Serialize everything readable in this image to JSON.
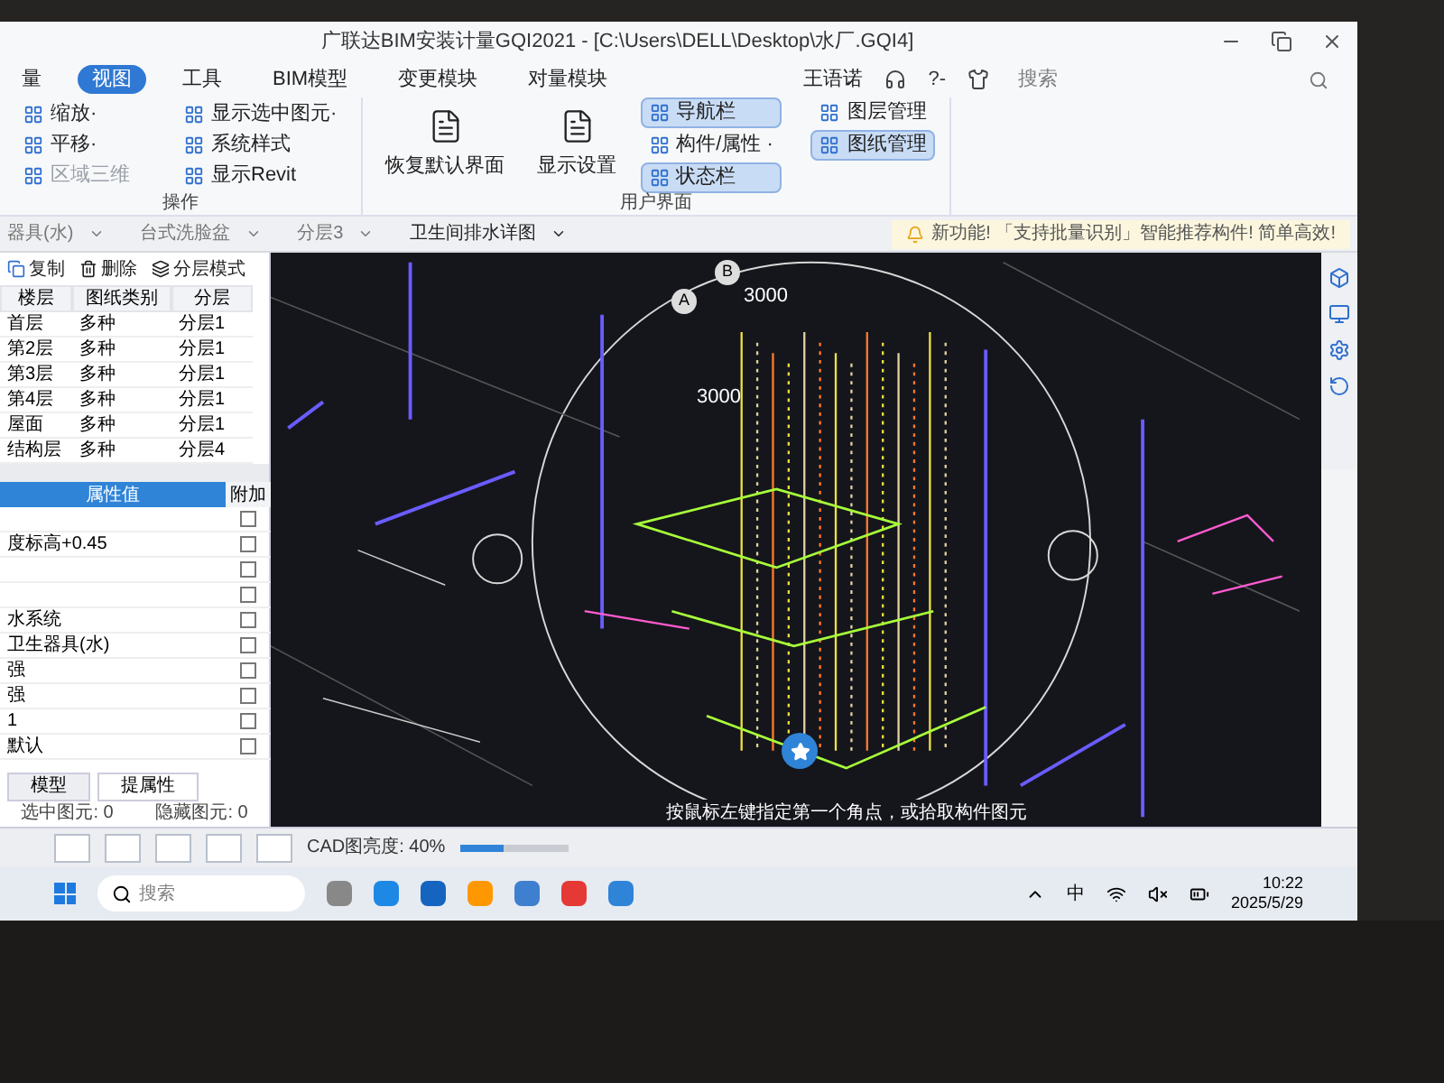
{
  "window": {
    "title": "广联达BIM安装计量GQI2021 - [C:\\Users\\DELL\\Desktop\\水厂.GQI4]",
    "user": "王语诺",
    "help": "?-",
    "search": {
      "placeholder": "搜索"
    }
  },
  "menu_tabs": [
    {
      "label": "量",
      "selected": false
    },
    {
      "label": "视图",
      "selected": true
    },
    {
      "label": "工具",
      "selected": false
    },
    {
      "label": "BIM模型",
      "selected": false
    },
    {
      "label": "变更模块",
      "selected": false
    },
    {
      "label": "对量模块",
      "selected": false
    }
  ],
  "ribbon_groups": [
    {
      "title": "操作",
      "items": [
        {
          "label": "缩放·",
          "kind": "small",
          "selected": false,
          "disabled": false
        },
        {
          "label": "平移·",
          "kind": "small",
          "selected": false,
          "disabled": false
        },
        {
          "label": "区域三维",
          "kind": "small",
          "selected": false,
          "disabled": true
        },
        {
          "label": "显示选中图元·",
          "kind": "small",
          "selected": false,
          "disabled": false
        },
        {
          "label": "系统样式",
          "kind": "small",
          "selected": false,
          "disabled": false
        },
        {
          "label": "显示Revit",
          "kind": "small",
          "selected": false,
          "disabled": false
        }
      ]
    },
    {
      "title": "用户界面",
      "items": [
        {
          "label": "恢复默认界面",
          "kind": "large",
          "selected": false,
          "disabled": false
        },
        {
          "label": "显示设置",
          "kind": "large",
          "selected": false,
          "disabled": false
        },
        {
          "label": "导航栏",
          "kind": "small",
          "selected": true,
          "disabled": false
        },
        {
          "label": "构件/属性 ·",
          "kind": "small",
          "selected": false,
          "disabled": false
        },
        {
          "label": "状态栏",
          "kind": "small",
          "selected": true,
          "disabled": false
        },
        {
          "label": "图层管理",
          "kind": "small",
          "selected": false,
          "disabled": false
        },
        {
          "label": "图纸管理",
          "kind": "small",
          "selected": true,
          "disabled": false
        }
      ]
    }
  ],
  "selectors": [
    "器具(水)",
    "台式洗脸盆",
    "分层3",
    "卫生间排水详图"
  ],
  "notice": "新功能! 「支持批量识别」智能推荐构件! 简单高效!",
  "drawing_panel": {
    "actions": [
      "复制",
      "删除",
      "分层模式"
    ],
    "columns": [
      "楼层",
      "图纸类别",
      "分层"
    ],
    "rows": [
      [
        "首层",
        "多种",
        "分层1"
      ],
      [
        "第2层",
        "多种",
        "分层1"
      ],
      [
        "第3层",
        "多种",
        "分层1"
      ],
      [
        "第4层",
        "多种",
        "分层1"
      ],
      [
        "屋面",
        "多种",
        "分层1"
      ],
      [
        "结构层",
        "多种",
        "分层4"
      ]
    ]
  },
  "property_panel": {
    "columns": [
      "属性值",
      "附加"
    ],
    "rows": [
      {
        "value": "",
        "checked": false
      },
      {
        "value": "度标高+0.45",
        "checked": false
      },
      {
        "value": "",
        "checked": false
      },
      {
        "value": "",
        "checked": false
      },
      {
        "value": "水系统",
        "checked": false
      },
      {
        "value": "卫生器具(水)",
        "checked": false
      },
      {
        "value": "强",
        "checked": false
      },
      {
        "value": "强",
        "checked": false
      },
      {
        "value": "1",
        "checked": false
      },
      {
        "value": "默认",
        "checked": false
      }
    ],
    "tabs": [
      {
        "label": "模型",
        "selected": false
      },
      {
        "label": "提属性",
        "selected": true
      }
    ],
    "status": [
      "选中图元: 0",
      "隐藏图元: 0"
    ]
  },
  "viewport": {
    "labels": [
      "A",
      "B",
      "3000",
      "3000"
    ],
    "hint": "按鼠标左键指定第一个角点，或拾取构件图元"
  },
  "bottom_toolbar": {
    "brightness_label": "CAD图亮度: 40%",
    "level": 0.4
  },
  "taskbar": {
    "search": {
      "placeholder": "搜索"
    },
    "ime": "中",
    "time": "10:22",
    "date": "2025/5/29"
  }
}
